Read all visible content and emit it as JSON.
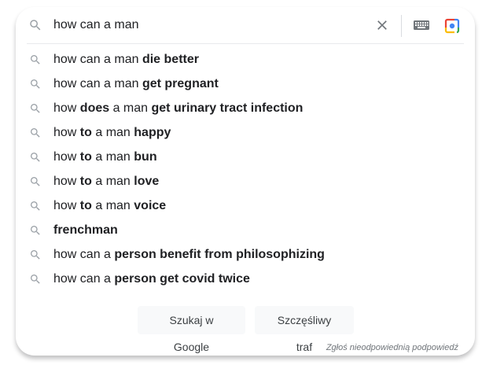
{
  "search": {
    "query": "how can a man",
    "icons": {
      "search": "search-icon",
      "clear": "close-icon",
      "keyboard": "keyboard-icon",
      "lens": "google-lens-icon"
    }
  },
  "suggestions": [
    {
      "parts": [
        {
          "t": "how can a man ",
          "b": false
        },
        {
          "t": "die better",
          "b": true
        }
      ]
    },
    {
      "parts": [
        {
          "t": "how can a man ",
          "b": false
        },
        {
          "t": "get pregnant",
          "b": true
        }
      ]
    },
    {
      "parts": [
        {
          "t": "how ",
          "b": false
        },
        {
          "t": "does",
          "b": true
        },
        {
          "t": " a man ",
          "b": false
        },
        {
          "t": "get urinary tract infection",
          "b": true
        }
      ]
    },
    {
      "parts": [
        {
          "t": "how ",
          "b": false
        },
        {
          "t": "to",
          "b": true
        },
        {
          "t": " a man ",
          "b": false
        },
        {
          "t": "happy",
          "b": true
        }
      ]
    },
    {
      "parts": [
        {
          "t": "how ",
          "b": false
        },
        {
          "t": "to",
          "b": true
        },
        {
          "t": " a man ",
          "b": false
        },
        {
          "t": "bun",
          "b": true
        }
      ]
    },
    {
      "parts": [
        {
          "t": "how ",
          "b": false
        },
        {
          "t": "to",
          "b": true
        },
        {
          "t": " a man ",
          "b": false
        },
        {
          "t": "love",
          "b": true
        }
      ]
    },
    {
      "parts": [
        {
          "t": "how ",
          "b": false
        },
        {
          "t": "to",
          "b": true
        },
        {
          "t": " a man ",
          "b": false
        },
        {
          "t": "voice",
          "b": true
        }
      ]
    },
    {
      "parts": [
        {
          "t": "frenchman",
          "b": true
        }
      ]
    },
    {
      "parts": [
        {
          "t": "how can a ",
          "b": false
        },
        {
          "t": "person benefit from philosophizing",
          "b": true
        }
      ]
    },
    {
      "parts": [
        {
          "t": "how can a ",
          "b": false
        },
        {
          "t": "person get covid twice",
          "b": true
        }
      ]
    }
  ],
  "buttons": {
    "search_label": "Szukaj w Google",
    "lucky_label": "Szczęśliwy traf"
  },
  "report_link": "Zgłoś nieodpowiednią podpowiedź",
  "colors": {
    "text": "#202124",
    "icon": "#9aa0a6",
    "button_bg": "#f8f9fa",
    "button_text": "#3c4043",
    "report_text": "#70757a"
  }
}
